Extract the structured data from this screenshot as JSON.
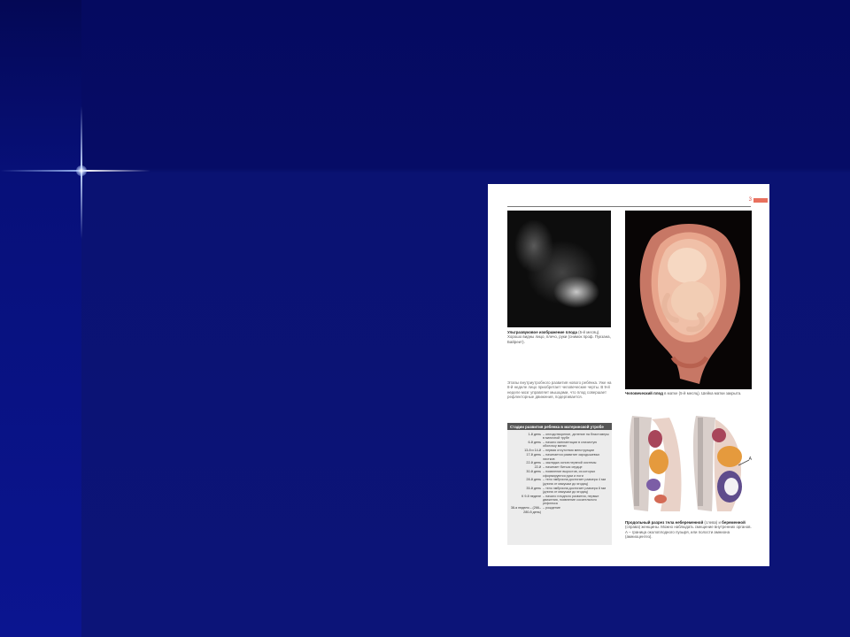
{
  "page": {
    "page_number": "3",
    "ultrasound_caption": {
      "bold": "Ультразвуковое изображение плода",
      "text": " (5-й месяц). Хорошо видны лицо, плечо, руки (снимок проф. Пукзана, Байреит)."
    },
    "intro_text": "Этапы внутриутробного развития нового ребёнка. Уже на 8-й неделе лицо приобретает человеческие черты. В 9-й неделе мозг управляет мышцами, что плод совершает рефлекторные движения, подергивается.",
    "fetus_caption": {
      "bold": "Человеческий плод",
      "text": " в матке (5-й месяц). Шейка матки закрыта."
    },
    "stages_table": {
      "title": "Стадии развития ребенка в материнской утробе",
      "rows": [
        {
          "day": "1-й день",
          "desc": "– оплодотворение, деление на бластомеры в маточной трубе"
        },
        {
          "day": "6-й день",
          "desc": "– начало имплантации в слизистую оболочку матки"
        },
        {
          "day": "13-й и 14-й",
          "desc": "– первая отсутствия менструации"
        },
        {
          "day": "17-й день",
          "desc": "– начинается развитие зародышевых листков"
        },
        {
          "day": "22-й день",
          "desc": "– закладка основ нервной системы"
        },
        {
          "day": "22-й",
          "desc": "– начинает биться сердце"
        },
        {
          "day": "30-й день",
          "desc": "– появление выростов, из которых сформируются руки и ноги"
        },
        {
          "day": "28-й день",
          "desc": "– тело эмбриона достигает размера 4 мм (длина от макушки до ягодиц)"
        },
        {
          "day": "35-й день",
          "desc": "– тело эмбриона достигает размера 8 мм (длина от макушки до ягодиц)"
        },
        {
          "day": "К 9-й неделе",
          "desc": "– начало плодного развития, первые движения, появление сосательного рефлекса"
        },
        {
          "day": "38-я неделя – (266–280-й день)",
          "desc": "– рождение"
        }
      ]
    },
    "sections_caption": {
      "bold1": "Продольный разрез тела небеременной",
      "text1": " (слева) и ",
      "bold2": "беременной",
      "text2": " (справа) женщины. Можно наблюдать смещение внутренних органов. А – граница околоплодного пузыря, или полости амниона (амниоцентез)."
    },
    "figure_label_a": "А"
  },
  "colors": {
    "slide_background": "#0a0f6e",
    "page_accent": "#e8705e",
    "tissue": "#d98a75"
  }
}
